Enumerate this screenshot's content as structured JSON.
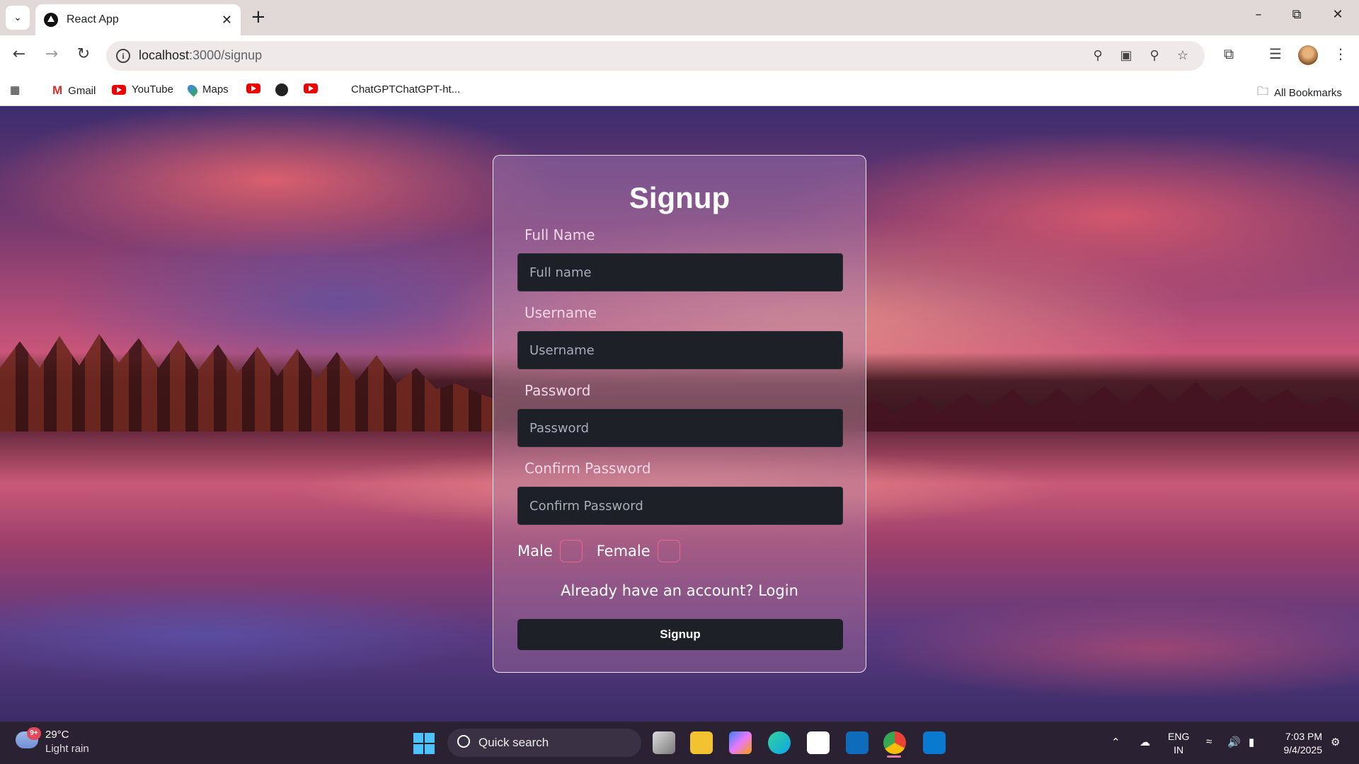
{
  "browser": {
    "tab_title": "React App",
    "url_host": "localhost",
    "url_path": ":3000/signup",
    "bookmarks": [
      "Gmail",
      "YouTube",
      "Maps",
      "ChatGPTChatGPT-ht..."
    ],
    "all_bookmarks": "All Bookmarks"
  },
  "signup": {
    "title": "Signup",
    "fullname_label": "Full Name",
    "fullname_placeholder": "Full name",
    "username_label": "Username",
    "username_placeholder": "Username",
    "password_label": "Password",
    "password_placeholder": "Password",
    "confirm_label": "Confirm Password",
    "confirm_placeholder": "Confirm Password",
    "male_label": "Male",
    "female_label": "Female",
    "login_prompt": "Already have an account? Login",
    "submit_label": "Signup"
  },
  "taskbar": {
    "weather_badge": "9+",
    "weather_temp": "29°C",
    "weather_desc": "Light rain",
    "search_text": "Quick search",
    "lang_line1": "ENG",
    "lang_line2": "IN",
    "time": "7:03 PM",
    "date": "9/4/2025"
  },
  "colors": {
    "accent_checkbox": "#e46a8e",
    "input_bg": "#1e2028",
    "taskbar_bg": "#2a2233"
  }
}
